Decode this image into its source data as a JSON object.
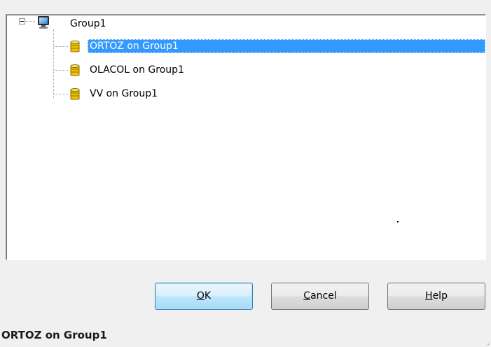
{
  "tree": {
    "root": {
      "label": "Group1",
      "expanded": true,
      "icon": "computer-icon"
    },
    "children": [
      {
        "label": "ORTOZ on Group1",
        "icon": "database-icon",
        "selected": true
      },
      {
        "label": "OLACOL on Group1",
        "icon": "database-icon",
        "selected": false
      },
      {
        "label": "VV on Group1",
        "icon": "database-icon",
        "selected": false
      }
    ]
  },
  "buttons": {
    "ok": {
      "mnemonic": "O",
      "rest": "K"
    },
    "cancel": {
      "mnemonic": "C",
      "rest": "ancel"
    },
    "help": {
      "mnemonic": "H",
      "rest": "elp"
    }
  },
  "status": {
    "text": "ORTOZ on Group1"
  },
  "colors": {
    "selection": "#3399ff",
    "dialog_bg": "#f0f0f0",
    "db_icon": "#f2c200"
  }
}
